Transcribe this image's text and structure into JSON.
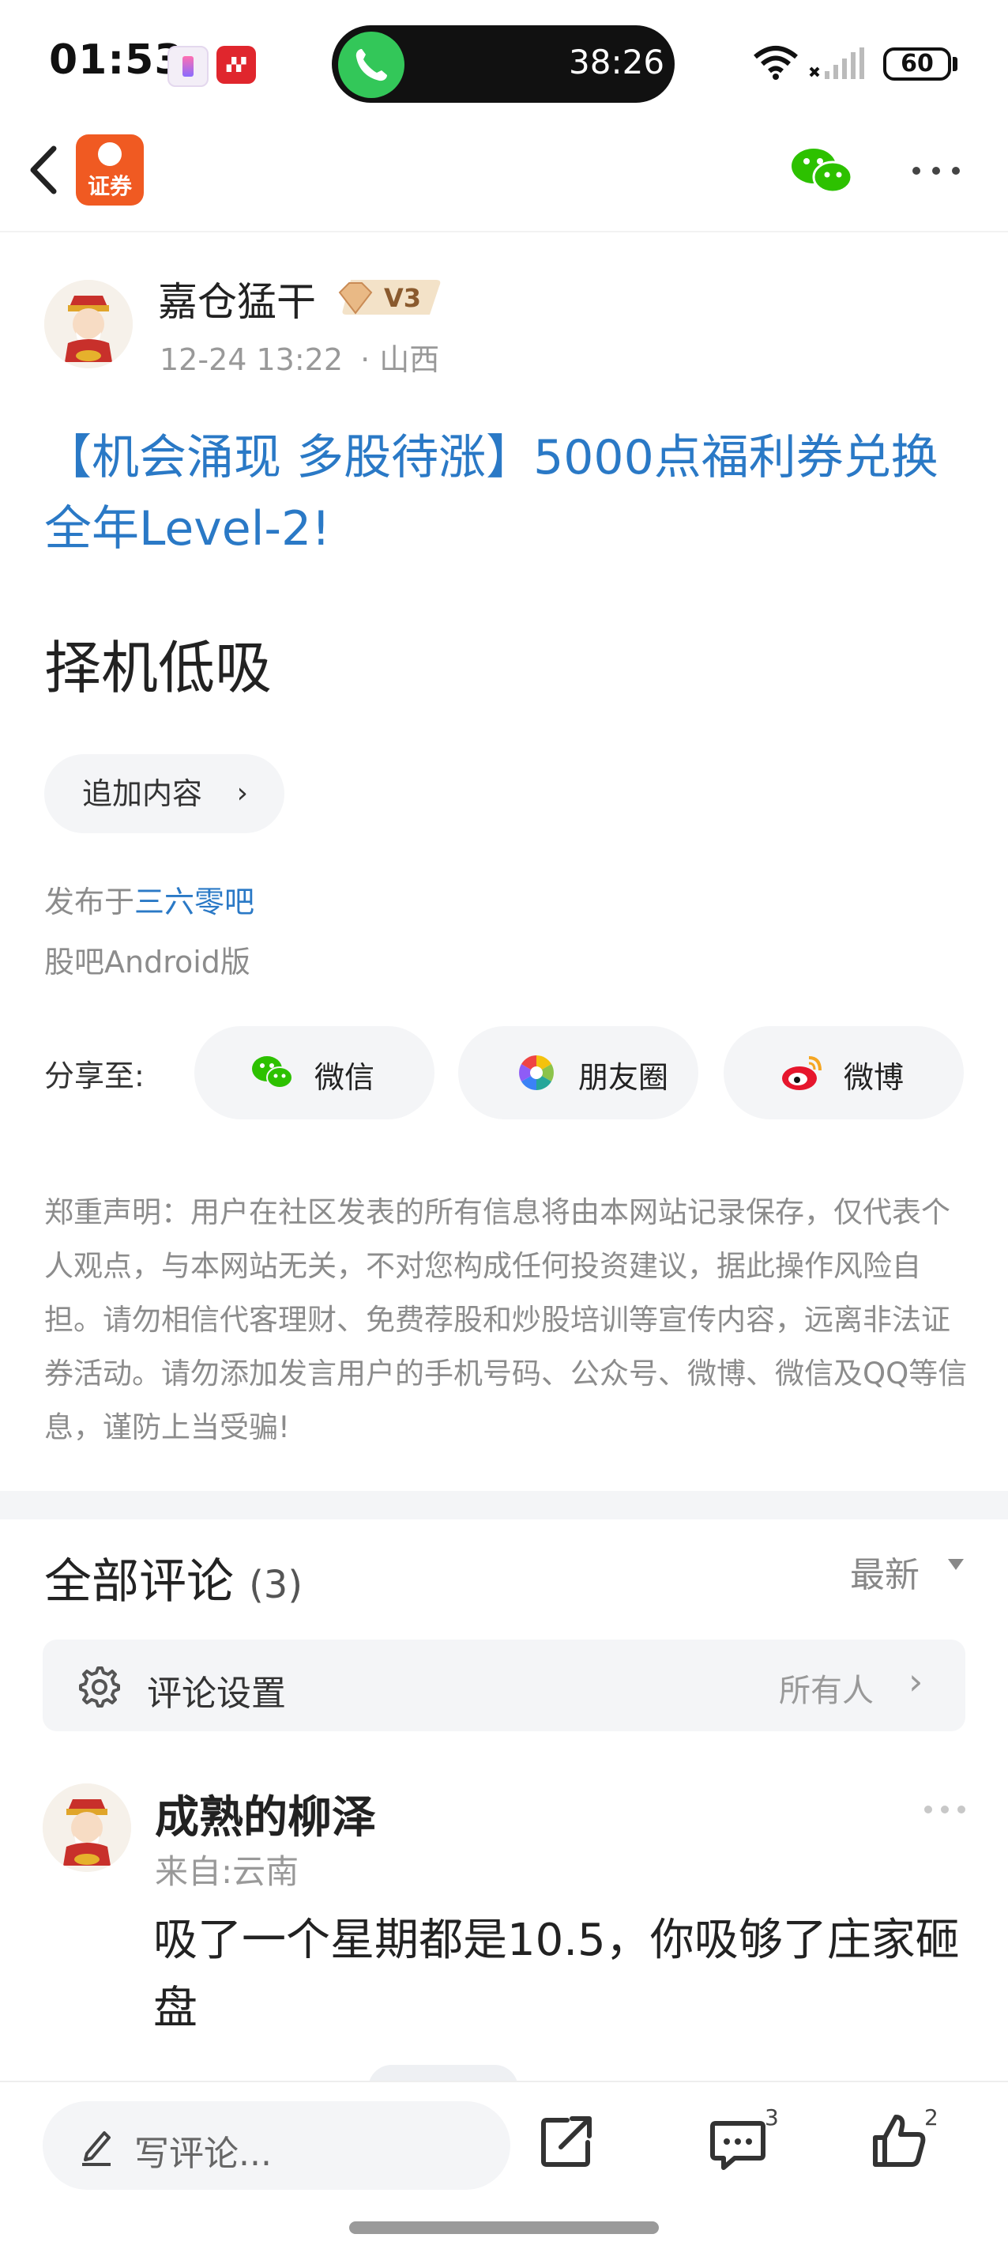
{
  "status_bar": {
    "time": "01:53",
    "call_duration": "38:26",
    "battery": "60"
  },
  "nav": {
    "logo_text": "证券"
  },
  "author": {
    "name": "嘉仓猛干",
    "level": "V3",
    "datetime": "12-24 13:22",
    "location": "· 山西"
  },
  "post": {
    "title": "【机会涌现 多股待涨】5000点福利券兑换全年Level-2!",
    "body": "择机低吸",
    "add_content_label": "追加内容",
    "published_prefix": "发布于",
    "bar_name": "三六零吧",
    "client": "股吧Android版"
  },
  "share": {
    "label": "分享至:",
    "wechat": "微信",
    "moments": "朋友圈",
    "weibo": "微博"
  },
  "disclaimer": "郑重声明：用户在社区发表的所有信息将由本网站记录保存，仅代表个人观点，与本网站无关，不对您构成任何投资建议，据此操作风险自担。请勿相信代客理财、免费荐股和炒股培训等宣传内容，远离非法证券活动。请勿添加发言用户的手机号码、公众号、微博、微信及QQ等信息，谨防上当受骗!",
  "comments": {
    "title": "全部评论",
    "count": "(3)",
    "sort": "最新",
    "settings_label": "评论设置",
    "settings_value": "所有人",
    "items": [
      {
        "name": "成熟的柳泽",
        "location": "来自:云南",
        "text": "吸了一个星期都是10.5，你吸够了庄家砸盘"
      }
    ]
  },
  "bottom_bar": {
    "write_placeholder": "写评论...",
    "comment_count": "3",
    "like_count": "2"
  },
  "colors": {
    "link_blue": "#2a79c6",
    "logo_orange": "#f05a22",
    "wechat_green": "#2dc100"
  }
}
